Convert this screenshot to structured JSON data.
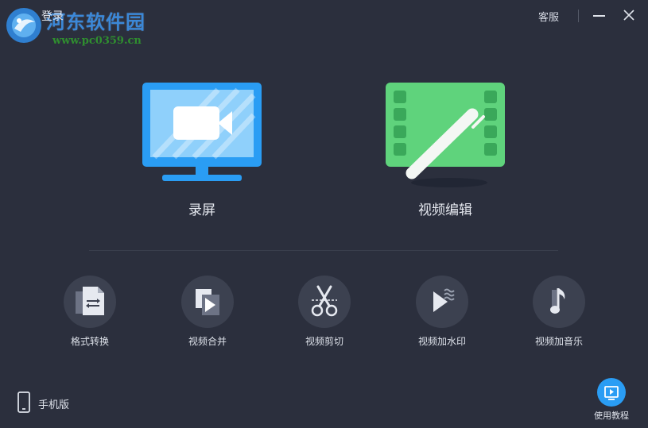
{
  "titlebar": {
    "login_label": "登录",
    "service_label": "客服"
  },
  "watermark": {
    "site_name": "河东软件园",
    "url": "www.pc0359.cn"
  },
  "features": [
    {
      "label": "录屏",
      "icon": "monitor-camera-icon"
    },
    {
      "label": "视频编辑",
      "icon": "film-pen-icon"
    }
  ],
  "tools": [
    {
      "label": "格式转换",
      "icon": "format-convert-icon"
    },
    {
      "label": "视频合并",
      "icon": "video-merge-icon"
    },
    {
      "label": "视频剪切",
      "icon": "scissors-icon"
    },
    {
      "label": "视频加水印",
      "icon": "watermark-icon"
    },
    {
      "label": "视频加音乐",
      "icon": "music-note-icon"
    }
  ],
  "footer": {
    "mobile_label": "手机版",
    "tutorial_label": "使用教程"
  },
  "colors": {
    "background": "#2b2f3d",
    "record_blue": "#2a9df4",
    "edit_green": "#5fd37c",
    "tool_circle": "#3c4150"
  }
}
